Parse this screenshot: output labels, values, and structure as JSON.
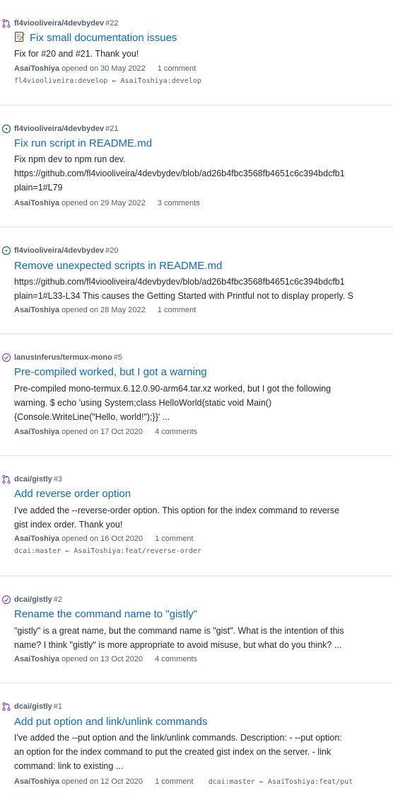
{
  "colors": {
    "pr_icon": "#8250df",
    "open_icon": "#1a7f37",
    "closed_icon": "#8250df",
    "link": "#0969da",
    "muted": "#57606a"
  },
  "items": [
    {
      "icon": "pull-request-icon",
      "repo": "fl4viooliveira/4devbydev",
      "number": "#22",
      "emoji": "memo-emoji",
      "title": "Fix small documentation issues",
      "body": [
        "Fix for #20 and #21. Thank you!"
      ],
      "author": "AsaiToshiya",
      "opened": "opened on 30 May 2022",
      "comments": "1 comment",
      "branch": "fl4viooliveira:develop ← AsaiToshiya:develop"
    },
    {
      "icon": "issue-opened-icon",
      "repo": "fl4viooliveira/4devbydev",
      "number": "#21",
      "title": "Fix run script in README.md",
      "body": [
        "Fix npm dev to npm run dev.",
        "https://github.com/fl4viooliveira/4devbydev/blob/ad26b4fbc3568fb4651c6c394bdcfb1",
        "plain=1#L79"
      ],
      "author": "AsaiToshiya",
      "opened": "opened on 29 May 2022",
      "comments": "3 comments"
    },
    {
      "icon": "issue-opened-icon",
      "repo": "fl4viooliveira/4devbydev",
      "number": "#20",
      "title": "Remove unexpected scripts in README.md",
      "body": [
        "https://github.com/fl4viooliveira/4devbydev/blob/ad26b4fbc3568fb4651c6c394bdcfb1",
        "plain=1#L33-L34 This causes the Getting Started with Printful not to display properly. S"
      ],
      "author": "AsaiToshiya",
      "opened": "opened on 28 May 2022",
      "comments": "1 comment"
    },
    {
      "icon": "issue-closed-icon",
      "repo": "lanusInferus/termux-mono",
      "number": "#5",
      "title": "Pre-compiled worked, but I got a warning",
      "body": [
        "Pre-compiled mono-termux.6.12.0.90-arm64.tar.xz worked, but I got the following",
        "warning. $ echo 'using System;class HelloWorld{static void Main()",
        "{Console.WriteLine(\"Hello, world!\");}}' ..."
      ],
      "author": "AsaiToshiya",
      "opened": "opened on 17 Oct 2020",
      "comments": "4 comments"
    },
    {
      "icon": "pull-request-icon",
      "repo": "dcai/gistly",
      "number": "#3",
      "title": "Add reverse order option",
      "body": [
        "I've added the --reverse-order option. This option for the index command to reverse",
        "gist index order. Thank you!"
      ],
      "author": "AsaiToshiya",
      "opened": "opened on 16 Oct 2020",
      "comments": "1 comment",
      "branch": "dcai:master ← AsaiToshiya:feat/reverse-order"
    },
    {
      "icon": "issue-closed-icon",
      "repo": "dcai/gistly",
      "number": "#2",
      "title": "Rename the command name to \"gistly\"",
      "body": [
        "\"gistly\" is a great name, but the command name is \"gist\". What is the intention of this",
        "name? I think \"gistly\" is more appropriate to avoid misuse, but what do you think? ..."
      ],
      "author": "AsaiToshiya",
      "opened": "opened on 13 Oct 2020",
      "comments": "4 comments"
    },
    {
      "icon": "pull-request-icon",
      "repo": "dcai/gistly",
      "number": "#1",
      "title": "Add put option and link/unlink commands",
      "body": [
        "I've added the --put option and the link/unlink commands. Description: - --put option:",
        "an option for the index command to put the created gist index on the server. - link",
        "command: link to existing ..."
      ],
      "author": "AsaiToshiya",
      "opened": "opened on 12 Oct 2020",
      "comments": "1 comment",
      "branch_inline": "dcai:master ← AsaiToshiya:feat/put"
    }
  ]
}
